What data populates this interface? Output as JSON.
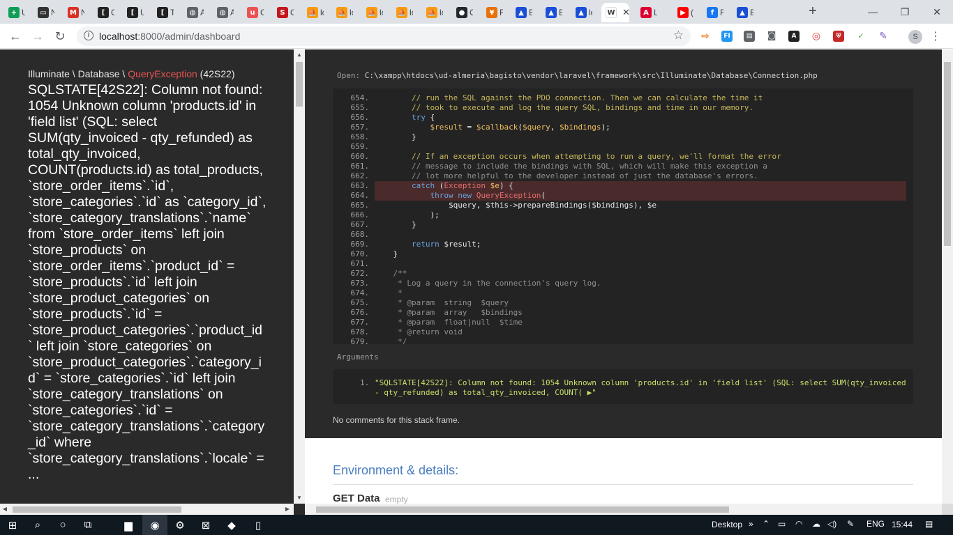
{
  "browser": {
    "tabs": [
      {
        "favicon": "sheets-icon",
        "letter": "+",
        "color": "#0f9d58",
        "title": "U"
      },
      {
        "favicon": "laptop-icon",
        "letter": "▭",
        "color": "#333333",
        "title": "N"
      },
      {
        "favicon": "gmail-icon",
        "letter": "M",
        "color": "#d93025",
        "title": "N"
      },
      {
        "favicon": "bracket-icon",
        "letter": "[",
        "color": "#222222",
        "title": "C"
      },
      {
        "favicon": "bracket-icon",
        "letter": "[",
        "color": "#222222",
        "title": "U"
      },
      {
        "favicon": "bracket-icon",
        "letter": "[",
        "color": "#222222",
        "title": "T"
      },
      {
        "favicon": "globe-icon",
        "letter": "◍",
        "color": "#5f6368",
        "title": "A"
      },
      {
        "favicon": "globe-icon",
        "letter": "◍",
        "color": "#5f6368",
        "title": "A"
      },
      {
        "favicon": "udemy-icon",
        "letter": "u",
        "color": "#ec5252",
        "title": "C"
      },
      {
        "favicon": "s-icon",
        "letter": "S",
        "color": "#c4161c",
        "title": "C"
      },
      {
        "favicon": "phpmyadmin-icon",
        "letter": "⛵",
        "color": "#f89c0e",
        "title": "lc"
      },
      {
        "favicon": "phpmyadmin-icon",
        "letter": "⛵",
        "color": "#f89c0e",
        "title": "lc"
      },
      {
        "favicon": "phpmyadmin-icon",
        "letter": "⛵",
        "color": "#f89c0e",
        "title": "lc"
      },
      {
        "favicon": "phpmyadmin-icon",
        "letter": "⛵",
        "color": "#f89c0e",
        "title": "lc"
      },
      {
        "favicon": "phpmyadmin-icon",
        "letter": "⛵",
        "color": "#f89c0e",
        "title": "lc"
      },
      {
        "favicon": "github-icon",
        "letter": "●",
        "color": "#24292e",
        "title": "C"
      },
      {
        "favicon": "fox-icon",
        "letter": "¥",
        "color": "#e8710a",
        "title": "F"
      },
      {
        "favicon": "bag-icon",
        "letter": "▲",
        "color": "#1a4fd6",
        "title": "E"
      },
      {
        "favicon": "bag-icon",
        "letter": "▲",
        "color": "#1a4fd6",
        "title": "E"
      },
      {
        "favicon": "bag-icon",
        "letter": "▲",
        "color": "#1a4fd6",
        "title": "lc"
      },
      {
        "favicon": "w-icon",
        "letter": "W",
        "color": "#ffffff",
        "title": "W",
        "active": true
      },
      {
        "favicon": "angular-icon",
        "letter": "A",
        "color": "#dd0031",
        "title": "L"
      },
      {
        "favicon": "youtube-icon",
        "letter": "▶",
        "color": "#ff0000",
        "title": "("
      },
      {
        "favicon": "facebook-icon",
        "letter": "f",
        "color": "#1877f2",
        "title": "F"
      },
      {
        "favicon": "bag-icon",
        "letter": "▲",
        "color": "#1a4fd6",
        "title": "E"
      }
    ],
    "new_tab": "+",
    "url_host": "localhost",
    "url_path": ":8000/admin/dashboard",
    "window_buttons": [
      "—",
      "❐",
      "✕"
    ],
    "profile_initial": "S"
  },
  "exception": {
    "namespace_prefix": "Illuminate \\ Database \\ ",
    "class_name": "QueryException",
    "code": " (42S22)",
    "message": "SQLSTATE[42S22]: Column not found: 1054 Unknown column 'products.id' in 'field list' (SQL: select SUM(qty_invoiced - qty_refunded) as total_qty_invoiced, COUNT(products.id) as total_products, `store_order_items`.`id`, `store_categories`.`id` as `category_id`, `store_category_translations`.`name` from `store_order_items` left join `store_products` on `store_order_items`.`product_id` = `store_products`.`id` left join `store_product_categories` on `store_products`.`id` = `store_product_categories`.`product_id` left join `store_categories` on `store_product_categories`.`category_id` = `store_categories`.`id` left join `store_category_translations` on `store_categories`.`id` = `store_category_translations`.`category_id` where `store_category_translations`.`locale` = ..."
  },
  "details": {
    "open_label": "Open: ",
    "file_path": "C:\\xampp\\htdocs\\ud-almeria\\bagisto\\vendor\\laravel\\framework\\src\\Illuminate\\Database\\Connection.php",
    "code_lines": [
      {
        "n": "654.",
        "t": "        // run the SQL against the PDO connection. Then we can calculate the time it",
        "k": "cmt2"
      },
      {
        "n": "655.",
        "t": "        // took to execute and log the query SQL, bindings and time in our memory.",
        "k": "cmt2"
      },
      {
        "n": "656.",
        "t": "        try {",
        "k": "kw"
      },
      {
        "n": "657.",
        "t": "            $result = $callback($query, $bindings);",
        "k": "var"
      },
      {
        "n": "658.",
        "t": "        }",
        "k": "kw"
      },
      {
        "n": "659.",
        "t": "",
        "k": ""
      },
      {
        "n": "660.",
        "t": "        // If an exception occurs when attempting to run a query, we'll format the error",
        "k": "cmt2"
      },
      {
        "n": "661.",
        "t": "        // message to include the bindings with SQL, which will make this exception a",
        "k": "cmt"
      },
      {
        "n": "662.",
        "t": "        // lot more helpful to the developer instead of just the database's errors.",
        "k": "cmt"
      },
      {
        "n": "663.",
        "t": "        catch (Exception $e) {",
        "k": "mix1",
        "hl": true
      },
      {
        "n": "664.",
        "t": "            throw new QueryException(",
        "k": "mix2",
        "hl": true
      },
      {
        "n": "665.",
        "t": "                $query, $this->prepareBindings($bindings), $e",
        "k": "plain"
      },
      {
        "n": "666.",
        "t": "            );",
        "k": "plain"
      },
      {
        "n": "667.",
        "t": "        }",
        "k": "plain"
      },
      {
        "n": "668.",
        "t": "",
        "k": ""
      },
      {
        "n": "669.",
        "t": "        return $result;",
        "k": "mix3"
      },
      {
        "n": "670.",
        "t": "    }",
        "k": "plain"
      },
      {
        "n": "671.",
        "t": "",
        "k": ""
      },
      {
        "n": "672.",
        "t": "    /**",
        "k": "cmt"
      },
      {
        "n": "673.",
        "t": "     * Log a query in the connection's query log.",
        "k": "cmt"
      },
      {
        "n": "674.",
        "t": "     *",
        "k": "cmt"
      },
      {
        "n": "675.",
        "t": "     * @param  string  $query",
        "k": "cmt"
      },
      {
        "n": "676.",
        "t": "     * @param  array   $bindings",
        "k": "cmt"
      },
      {
        "n": "677.",
        "t": "     * @param  float|null  $time",
        "k": "cmt"
      },
      {
        "n": "678.",
        "t": "     * @return void",
        "k": "cmt"
      },
      {
        "n": "679.",
        "t": "     */",
        "k": "cmt"
      }
    ],
    "arguments_label": "Arguments",
    "argument_number": "1.",
    "argument_value": "\"SQLSTATE[42S22]: Column not found: 1054 Unknown column 'products.id' in 'field list' (SQL: select SUM(qty_invoiced - qty_refunded) as total_qty_invoiced, COUNT( ▶\"",
    "no_comments": "No comments for this stack frame.",
    "environment_title": "Environment & details:",
    "get_data_label": "GET Data",
    "get_data_empty": "empty"
  },
  "taskbar": {
    "items": [
      {
        "name": "windows-start-icon",
        "glyph": "⊞"
      },
      {
        "name": "search-icon",
        "glyph": "⌕"
      },
      {
        "name": "cortana-icon",
        "glyph": "○"
      },
      {
        "name": "task-view-icon",
        "glyph": "⧉"
      },
      {
        "name": "file-explorer-icon",
        "glyph": "▆"
      },
      {
        "name": "chrome-icon",
        "glyph": "◉",
        "active": true
      },
      {
        "name": "app-icon",
        "glyph": "⚙"
      },
      {
        "name": "xampp-icon",
        "glyph": "⊠"
      },
      {
        "name": "vscode-icon",
        "glyph": "◆"
      },
      {
        "name": "notepad-icon",
        "glyph": "▯"
      }
    ],
    "desktop_label": "Desktop",
    "tray_chevron": "»",
    "language": "ENG",
    "time": "15:44"
  }
}
